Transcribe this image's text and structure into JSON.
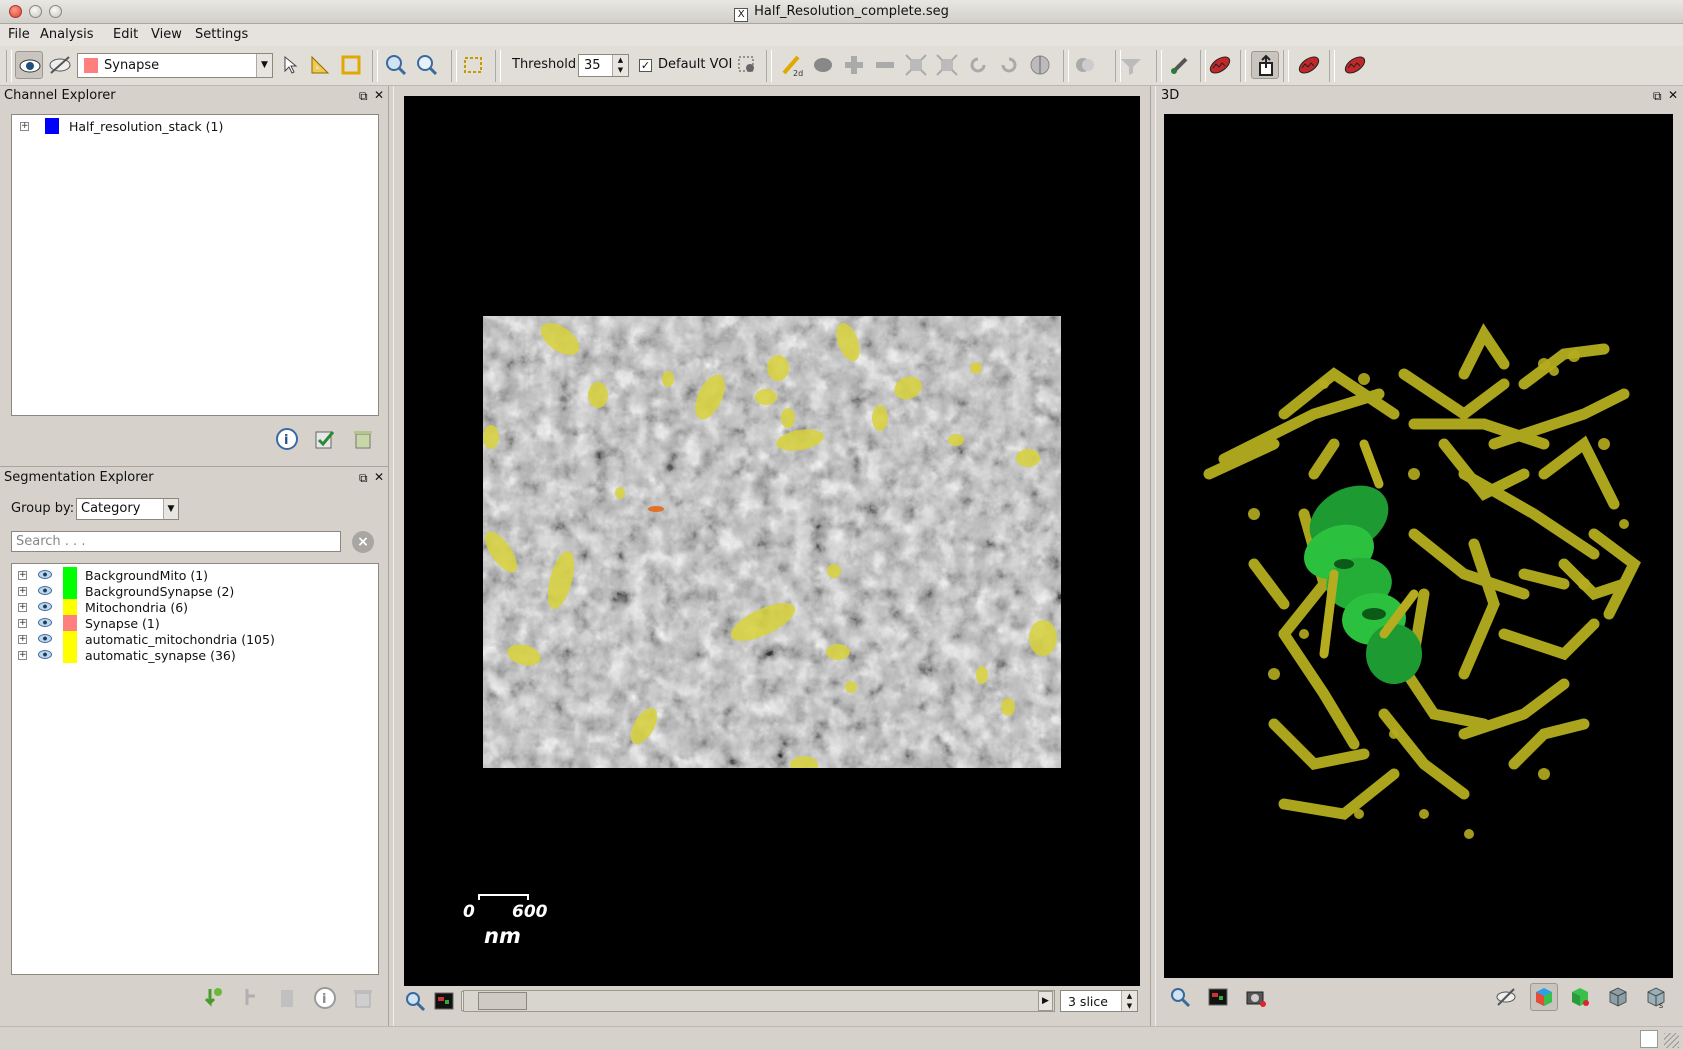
{
  "window": {
    "title": "Half_Resolution_complete.seg"
  },
  "menu": {
    "file": "File",
    "analysis": "Analysis",
    "edit": "Edit",
    "view": "View",
    "settings": "Settings"
  },
  "toolbar": {
    "category_selected": "Synapse",
    "category_color": "#ff7f7f",
    "threshold_label": "Threshold",
    "threshold_value": "35",
    "default_voi_label": "Default VOI",
    "default_voi_checked": true
  },
  "channel_explorer": {
    "title": "Channel Explorer",
    "items": [
      {
        "label": "Half_resolution_stack (1)",
        "color": "#0000ff"
      }
    ]
  },
  "segmentation_explorer": {
    "title": "Segmentation Explorer",
    "group_by_label": "Group by:",
    "group_by_value": "Category",
    "search_placeholder": "Search . . .",
    "items": [
      {
        "label": "BackgroundMito (1)",
        "color": "#00ff00"
      },
      {
        "label": "BackgroundSynapse (2)",
        "color": "#00ff00"
      },
      {
        "label": "Mitochondria (6)",
        "color": "#ffff00"
      },
      {
        "label": "Synapse (1)",
        "color": "#ff7f7f"
      },
      {
        "label": "automatic_mitochondria (105)",
        "color": "#ffff00"
      },
      {
        "label": "automatic_synapse (36)",
        "color": "#ffff00"
      }
    ]
  },
  "view2d": {
    "scale_min": "0",
    "scale_max": "600",
    "scale_unit": "nm",
    "slice_value": "3 slice"
  },
  "view3d": {
    "title": "3D"
  }
}
